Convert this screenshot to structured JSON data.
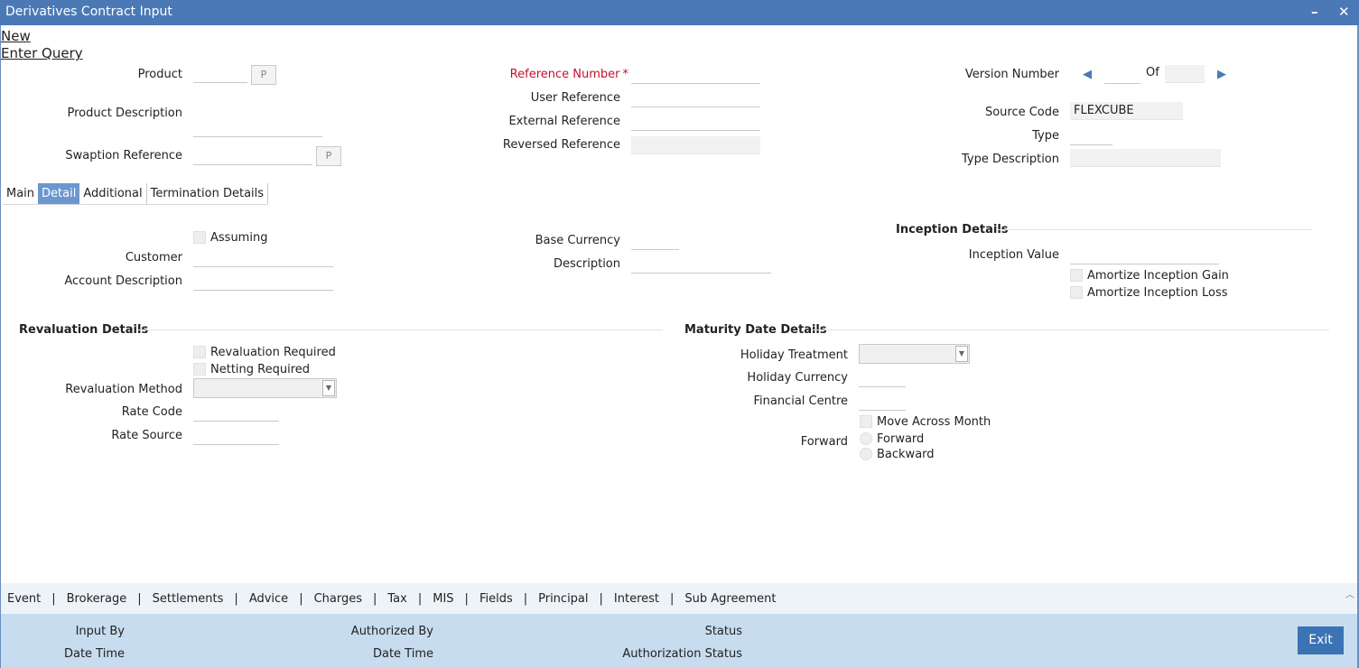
{
  "window": {
    "title": "Derivatives Contract Input",
    "minimize_glyph": "–",
    "close_glyph": "✕"
  },
  "actions": {
    "new": "New",
    "enter_query": "Enter Query"
  },
  "header": {
    "product_label": "Product",
    "product_value": "",
    "p_button": "P",
    "product_description_label": "Product Description",
    "swaption_reference_label": "Swaption Reference",
    "reference_number_label": "Reference Number",
    "required_marker": "*",
    "user_reference_label": "User Reference",
    "external_reference_label": "External Reference",
    "reversed_reference_label": "Reversed Reference",
    "version_number_label": "Version Number",
    "of_label": "Of",
    "source_code_label": "Source Code",
    "source_code_value": "FLEXCUBE",
    "type_label": "Type",
    "type_description_label": "Type Description"
  },
  "tabs": [
    {
      "label": "Main",
      "active": false
    },
    {
      "label": "Detail",
      "active": true
    },
    {
      "label": "Additional",
      "active": false
    },
    {
      "label": "Termination Details",
      "active": false
    }
  ],
  "detail": {
    "assuming_label": "Assuming",
    "customer_label": "Customer",
    "account_description_label": "Account Description",
    "base_currency_label": "Base Currency",
    "description_label": "Description",
    "inception": {
      "title": "Inception Details",
      "inception_value_label": "Inception Value",
      "amortize_gain_label": "Amortize Inception Gain",
      "amortize_loss_label": "Amortize Inception Loss"
    },
    "revaluation": {
      "title": "Revaluation Details",
      "revaluation_required_label": "Revaluation Required",
      "netting_required_label": "Netting Required",
      "revaluation_method_label": "Revaluation Method",
      "rate_code_label": "Rate Code",
      "rate_source_label": "Rate Source"
    },
    "maturity": {
      "title": "Maturity Date Details",
      "holiday_treatment_label": "Holiday Treatment",
      "holiday_currency_label": "Holiday Currency",
      "financial_centre_label": "Financial Centre",
      "move_across_month_label": "Move Across Month",
      "forward_label": "Forward",
      "forward_option": "Forward",
      "backward_option": "Backward"
    }
  },
  "bottom_nav": [
    "Event",
    "Brokerage",
    "Settlements",
    "Advice",
    "Charges",
    "Tax",
    "MIS",
    "Fields",
    "Principal",
    "Interest",
    "Sub Agreement"
  ],
  "nav_separator": "|",
  "footer": {
    "input_by_label": "Input By",
    "date_time_label": "Date Time",
    "authorized_by_label": "Authorized By",
    "date_time_label_2": "Date Time",
    "status_label": "Status",
    "authorization_status_label": "Authorization Status",
    "exit_button": "Exit"
  },
  "colors": {
    "titlebar": "#4a79b6",
    "active_tab": "#6b96cf",
    "required": "#c8102e",
    "footer": "#c7dcee",
    "exit_button": "#3c73b5"
  },
  "icons": {
    "prev_version": "triangle-left-icon",
    "next_version": "triangle-right-icon",
    "dropdown": "chevron-down-icon",
    "scroll_up": "chevron-up-icon"
  }
}
